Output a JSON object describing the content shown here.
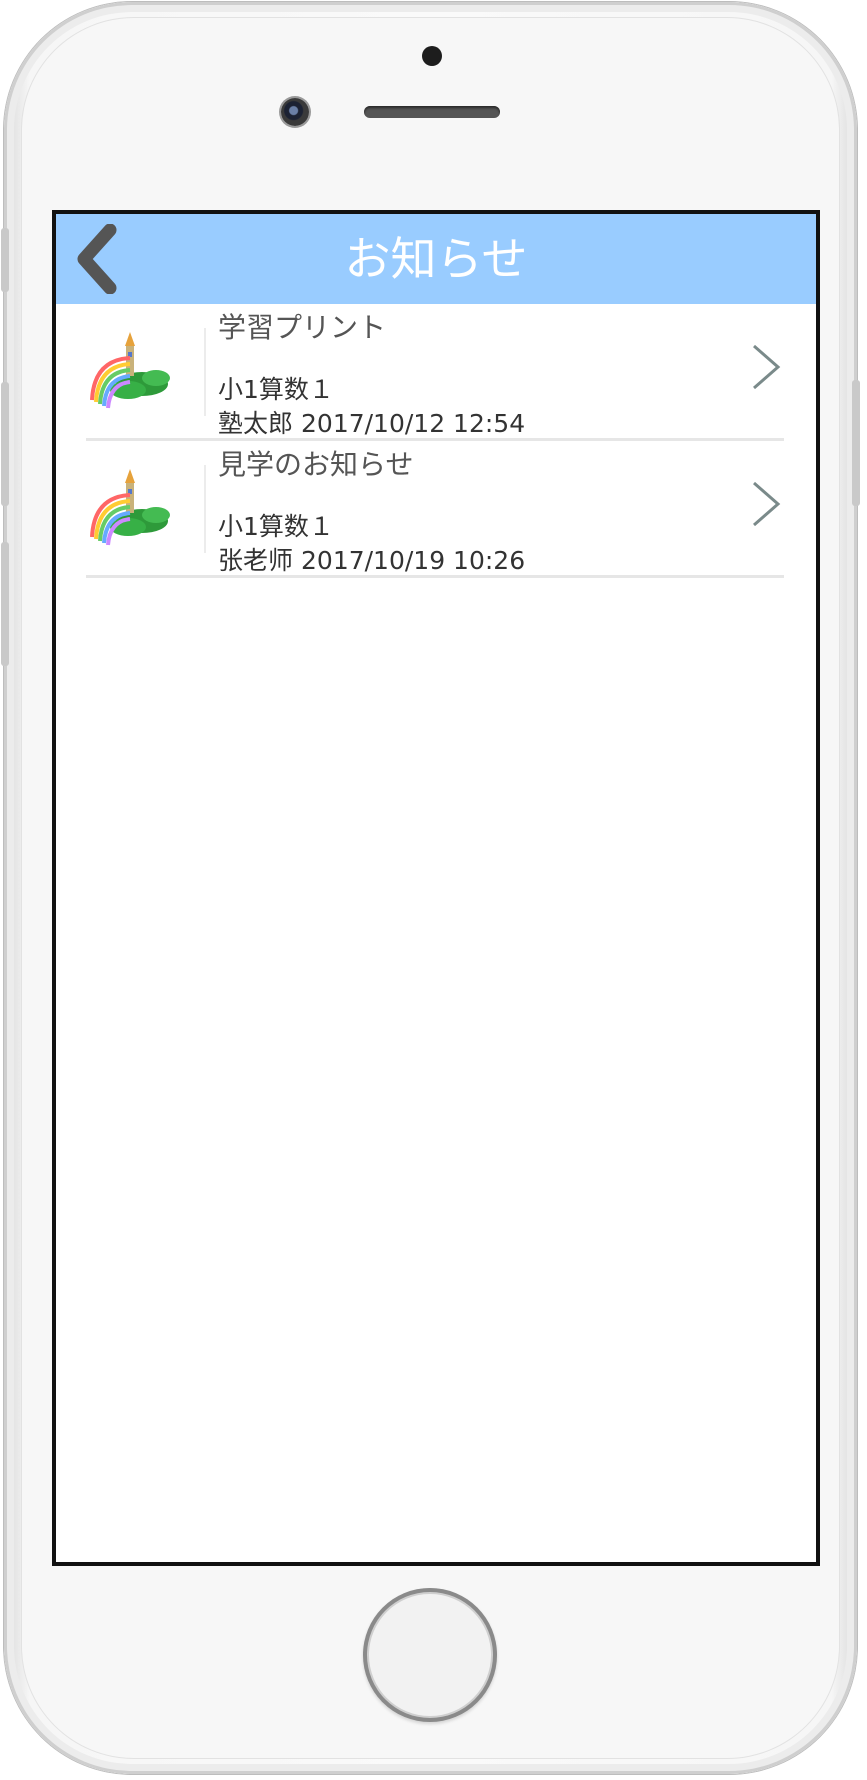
{
  "header": {
    "title": "お知らせ",
    "back_icon": "chevron-left-icon"
  },
  "colors": {
    "nav_bar": "#99ccff",
    "nav_title": "#ffffff",
    "back_icon": "#555555",
    "chevron": "#7a8a8a"
  },
  "notices": [
    {
      "title": "学習プリント",
      "class_name": "小1算数１",
      "sender": "塾太郎",
      "datetime": "2017/10/12 12:54",
      "thumbnail_icon": "rainbow-castle-icon",
      "chevron_icon": "chevron-right-icon"
    },
    {
      "title": "見学のお知らせ",
      "class_name": "小1算数１",
      "sender": "张老师",
      "datetime": "2017/10/19 10:26",
      "thumbnail_icon": "rainbow-castle-icon",
      "chevron_icon": "chevron-right-icon"
    }
  ]
}
